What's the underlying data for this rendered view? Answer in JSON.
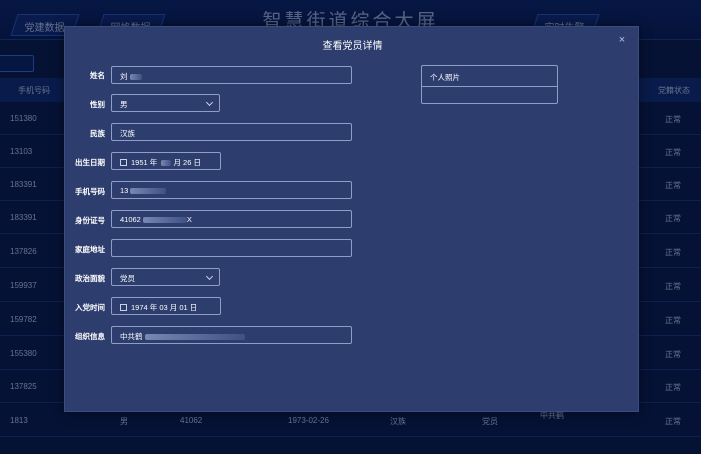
{
  "dashboard": {
    "title": "智慧街道综合大屏",
    "tabs": [
      "党建数据",
      "网格数据",
      "实时告警"
    ],
    "table_headers": {
      "phone": "手机号码",
      "status": "党籍状态"
    },
    "rows": [
      {
        "phone": "151380",
        "status": "正常"
      },
      {
        "phone": "13103",
        "status": "正常"
      },
      {
        "phone": "183391",
        "status": "正常"
      },
      {
        "phone": "183391",
        "status": "正常"
      },
      {
        "phone": "137826",
        "status": "正常"
      },
      {
        "phone": "159937",
        "status": "正常"
      },
      {
        "phone": "159782",
        "status": "正常"
      },
      {
        "phone": "155380",
        "status": "正常"
      },
      {
        "phone": "137825",
        "status": "正常"
      }
    ],
    "last_row": {
      "phone": "1813",
      "gender": "男",
      "id": "41062",
      "date": "1973-02-26",
      "ethnicity": "汉族",
      "political": "党员",
      "org": "中共鹤",
      "status": "正常"
    }
  },
  "modal": {
    "title": "查看党员详情",
    "close_glyph": "×",
    "photo_label": "个人照片",
    "fields": {
      "name": {
        "label": "姓名",
        "value": "刘"
      },
      "gender": {
        "label": "性别",
        "value": "男"
      },
      "ethnicity": {
        "label": "民族",
        "value": "汉族"
      },
      "birth": {
        "label": "出生日期",
        "value": "1951 年 ",
        "value2": " 月 26 日"
      },
      "phone": {
        "label": "手机号码",
        "value": "13"
      },
      "idcard": {
        "label": "身份证号",
        "value": "41062",
        "value2": "X"
      },
      "address": {
        "label": "家庭地址",
        "value": ""
      },
      "political": {
        "label": "政治面貌",
        "value": "党员"
      },
      "joined": {
        "label": "入党时间",
        "value": "1974 年 03 月 01 日"
      },
      "org": {
        "label": "组织信息",
        "value": "中共鹤"
      }
    }
  }
}
